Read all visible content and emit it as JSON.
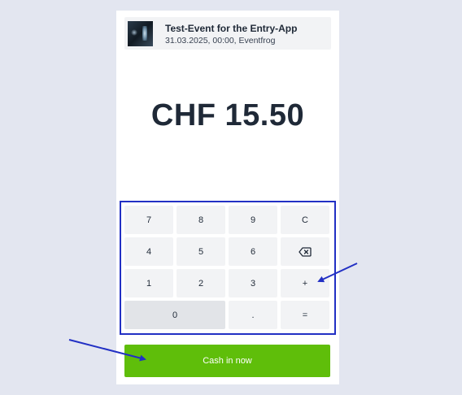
{
  "event": {
    "title": "Test-Event for the Entry-App",
    "meta": "31.03.2025, 00:00, Eventfrog"
  },
  "amount": "CHF 15.50",
  "keypad": {
    "k7": "7",
    "k8": "8",
    "k9": "9",
    "clear": "C",
    "k4": "4",
    "k5": "5",
    "k6": "6",
    "k1": "1",
    "k2": "2",
    "k3": "3",
    "plus": "+",
    "k0": "0",
    "dot": ".",
    "equals": "="
  },
  "cash_button": "Cash in now",
  "colors": {
    "background": "#e3e6f0",
    "card": "#ffffff",
    "key": "#f2f3f5",
    "primary_green": "#5fbe0a",
    "annotation_blue": "#2230c4"
  },
  "icons": {
    "backspace": "backspace-icon",
    "thumbnail": "event-thumbnail"
  }
}
